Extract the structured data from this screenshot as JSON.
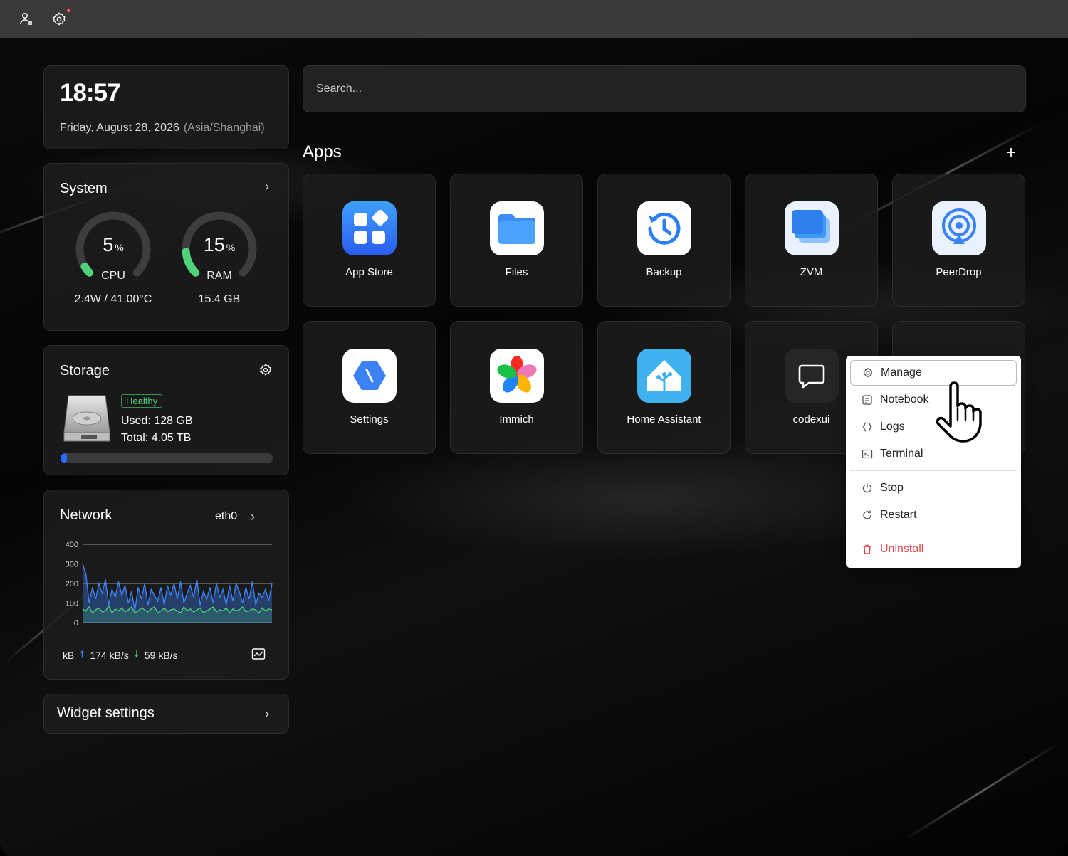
{
  "topbar": {
    "icons": [
      "user-list-icon",
      "gear-icon"
    ],
    "notification_dot_color": "#ff5a4d"
  },
  "clock": {
    "time": "18:57",
    "date": "Friday, August 28, 2026",
    "timezone": "(Asia/Shanghai)"
  },
  "system": {
    "title": "System",
    "cpu": {
      "value": "5",
      "unit": "%",
      "label": "CPU",
      "percent": 5,
      "detail": "2.4W / 41.00°C"
    },
    "ram": {
      "value": "15",
      "unit": "%",
      "label": "RAM",
      "percent": 15,
      "detail": "15.4 GB"
    },
    "gauge_color": "#4fd37a"
  },
  "storage": {
    "title": "Storage",
    "status": "Healthy",
    "used": "Used: 128 GB",
    "total": "Total: 4.05 TB",
    "usage_fraction": 0.03
  },
  "network": {
    "title": "Network",
    "interface": "eth0",
    "unit": "kB",
    "upload": "174 kB/s",
    "download": "59 kB/s",
    "upload_color": "#3d86ff",
    "download_color": "#4fd37a",
    "chart_data": {
      "type": "line",
      "title": "",
      "ylim": [
        0,
        400
      ],
      "yticks": [
        "400",
        "300",
        "200",
        "100",
        "0"
      ],
      "series": [
        {
          "values": [
            300,
            250,
            100,
            180,
            120,
            200,
            150,
            220,
            90,
            170,
            130,
            210,
            140,
            190,
            100,
            160,
            60,
            180,
            120,
            200,
            90,
            170,
            140,
            110,
            180,
            90,
            190,
            140,
            200,
            120,
            210,
            100,
            150,
            190,
            130,
            220,
            90,
            160,
            120,
            180,
            100,
            200,
            130,
            170,
            90,
            190,
            110,
            200,
            160,
            100,
            180,
            120,
            210,
            90,
            150,
            130,
            170,
            110,
            200
          ]
        },
        {
          "values": [
            70,
            60,
            80,
            50,
            65,
            75,
            55,
            60,
            85,
            50,
            70,
            60,
            75,
            55,
            65,
            80,
            50,
            60,
            75,
            65,
            55,
            70,
            80,
            50,
            60,
            75,
            55,
            65,
            70,
            60,
            50,
            80,
            60,
            70,
            55,
            65,
            75,
            50,
            60,
            70,
            80,
            55,
            65,
            60,
            75,
            50,
            70,
            60,
            65,
            80,
            55,
            60,
            70,
            65,
            50,
            75,
            60,
            70,
            65
          ]
        }
      ]
    }
  },
  "widget_settings": {
    "label": "Widget settings"
  },
  "search": {
    "placeholder": "Search..."
  },
  "apps": {
    "title": "Apps",
    "add_label": "+",
    "items": [
      {
        "label": "App Store",
        "icon": "app-store-icon"
      },
      {
        "label": "Files",
        "icon": "folder-icon"
      },
      {
        "label": "Backup",
        "icon": "backup-clock-icon"
      },
      {
        "label": "ZVM",
        "icon": "zvm-windows-icon"
      },
      {
        "label": "PeerDrop",
        "icon": "peerdrop-airdrop-icon"
      },
      {
        "label": "Settings",
        "icon": "settings-hexagon-icon"
      },
      {
        "label": "Immich",
        "icon": "immich-pinwheel-icon"
      },
      {
        "label": "Home Assistant",
        "icon": "home-assistant-icon"
      },
      {
        "label": "codexui",
        "icon": "chat-bubble-icon"
      }
    ]
  },
  "context_menu": {
    "items": [
      {
        "label": "Manage",
        "icon": "gear-icon"
      },
      {
        "label": "Notebook",
        "icon": "notebook-icon"
      },
      {
        "label": "Logs",
        "icon": "braces-icon"
      },
      {
        "label": "Terminal",
        "icon": "terminal-icon"
      },
      {
        "label": "Stop",
        "icon": "power-icon"
      },
      {
        "label": "Restart",
        "icon": "restart-icon"
      },
      {
        "label": "Uninstall",
        "icon": "trash-icon"
      }
    ],
    "danger_color": "#e5484d"
  }
}
